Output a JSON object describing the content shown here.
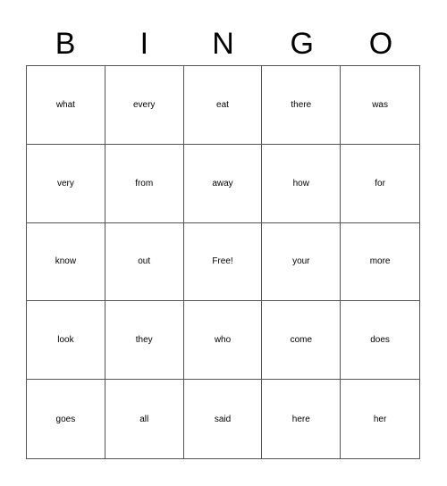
{
  "header": [
    "B",
    "I",
    "N",
    "G",
    "O"
  ],
  "cells": [
    [
      "what",
      "every",
      "eat",
      "there",
      "was"
    ],
    [
      "very",
      "from",
      "away",
      "how",
      "for"
    ],
    [
      "know",
      "out",
      "Free!",
      "your",
      "more"
    ],
    [
      "look",
      "they",
      "who",
      "come",
      "does"
    ],
    [
      "goes",
      "all",
      "said",
      "here",
      "her"
    ]
  ]
}
